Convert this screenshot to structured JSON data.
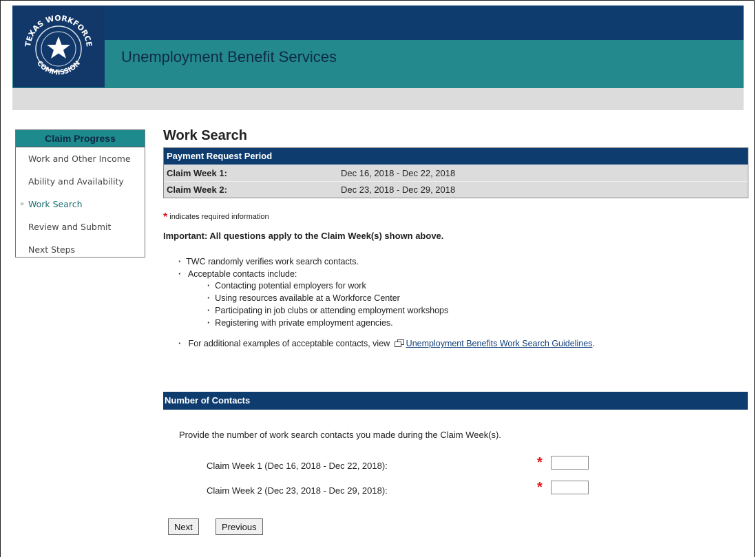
{
  "header": {
    "seal_text": "TEXAS WORKFORCE COMMISSION",
    "app_title": "Unemployment Benefit Services"
  },
  "sidebar": {
    "title": "Claim Progress",
    "items": [
      {
        "label": "Work and Other Income",
        "active": false
      },
      {
        "label": "Ability and Availability",
        "active": false
      },
      {
        "label": "Work Search",
        "active": true
      },
      {
        "label": "Review and Submit",
        "active": false
      },
      {
        "label": "Next Steps",
        "active": false
      }
    ]
  },
  "page": {
    "title": "Work Search",
    "period": {
      "heading": "Payment Request Period",
      "rows": [
        {
          "label": "Claim Week 1:",
          "value": "Dec 16, 2018 - Dec 22, 2018"
        },
        {
          "label": "Claim Week 2:",
          "value": "Dec 23, 2018 - Dec 29, 2018"
        }
      ]
    },
    "required_note": "indicates required information",
    "important": "Important: All questions apply to the Claim Week(s) shown above.",
    "bullets": {
      "b1": "TWC randomly verifies work search contacts.",
      "b2": "Acceptable contacts include:",
      "sub": [
        "Contacting potential employers for work",
        "Using resources available at a Workforce Center",
        "Participating in job clubs or attending employment workshops",
        "Registering with private employment agencies."
      ],
      "b3_prefix": "For additional examples of acceptable contacts, view",
      "b3_link": "Unemployment Benefits Work Search Guidelines",
      "b3_suffix": "."
    },
    "contacts": {
      "heading": "Number of Contacts",
      "prompt": "Provide the number of work search contacts you made during the Claim Week(s).",
      "week1_label": "Claim Week 1 (Dec 16, 2018 - Dec 22, 2018):",
      "week1_value": "",
      "week2_label": "Claim Week 2 (Dec 23, 2018 - Dec 29, 2018):",
      "week2_value": ""
    },
    "buttons": {
      "next": "Next",
      "previous": "Previous"
    }
  },
  "colors": {
    "header_dark": "#0e3c6e",
    "header_teal": "#23898c",
    "required_star": "#e4161b"
  }
}
